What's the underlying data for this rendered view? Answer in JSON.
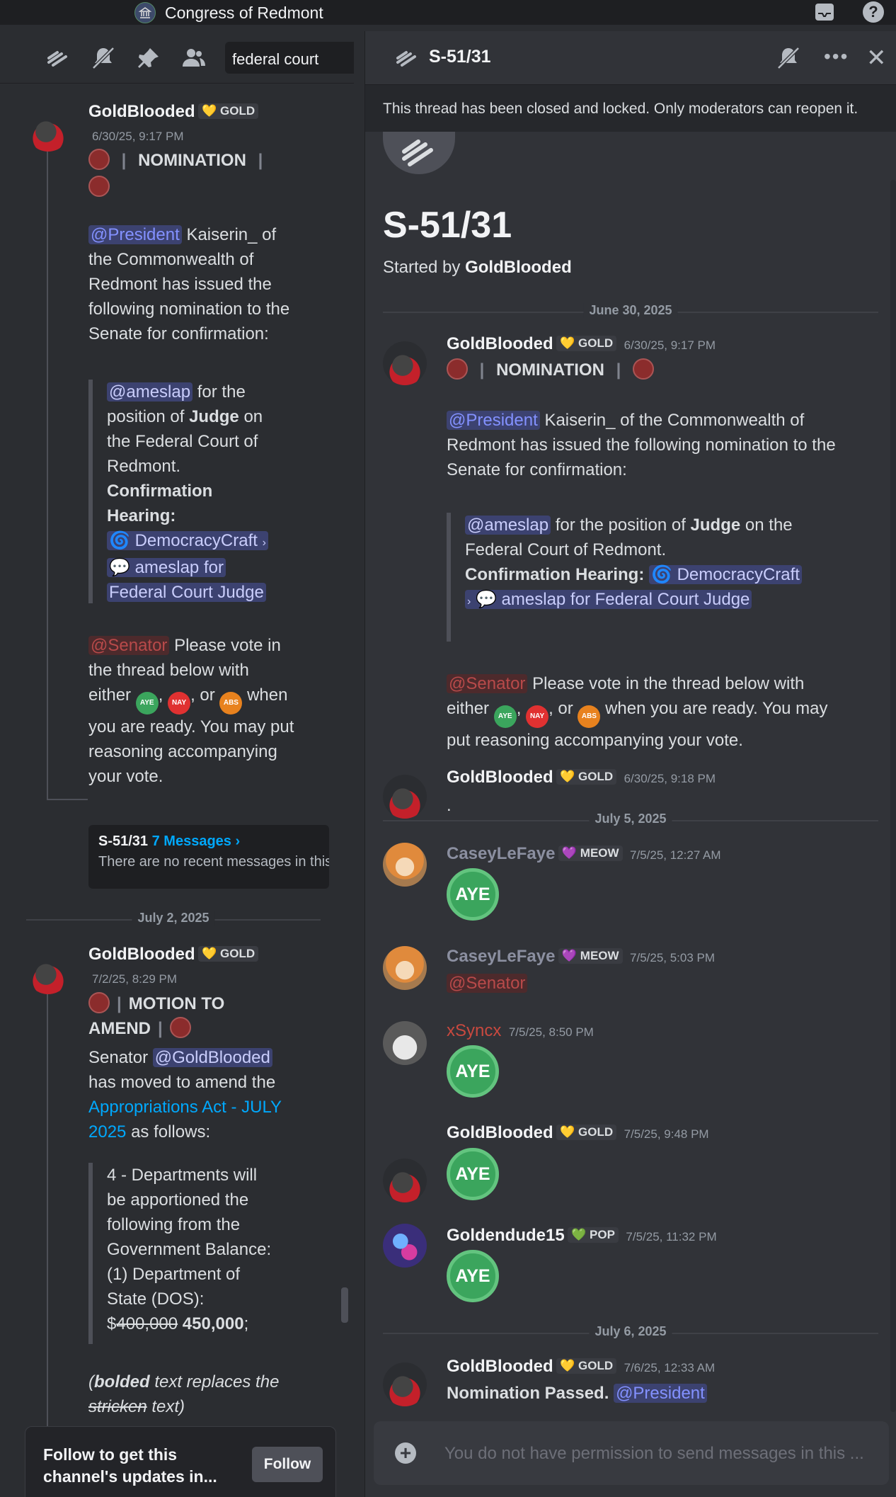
{
  "window": {
    "server_name": "Congress of Redmont"
  },
  "left_panel": {
    "search_value": "federal court",
    "msg1": {
      "author": "GoldBlooded",
      "tag": "GOLD",
      "timestamp": "6/30/25, 9:17 PM",
      "heading": "NOMINATION",
      "p1_mention": "@President",
      "p1_line1": "Kaiserin_ of",
      "p1_line2": "the Commonwealth of",
      "p1_line3": "Redmont has issued the",
      "p1_line4": "following nomination to the",
      "p1_line5": "Senate for confirmation:",
      "q_mention": "@ameslap",
      "q_line1": "for the",
      "q_line2a": "position of",
      "q_judge": "Judge",
      "q_line2b": "on",
      "q_line3": "the Federal Court of",
      "q_line4": "Redmont.",
      "q_hearing1": "Confirmation",
      "q_hearing2": "Hearing:",
      "q_channel": "DemocracyCraft",
      "q_thread1": "ameslap for",
      "q_thread2": "Federal Court Judge",
      "p2_mention": "@Senator",
      "p2_line1": "Please vote in",
      "p2_line2": "the thread below with",
      "p2_either": "either",
      "p2_or": ", or",
      "p2_when": "when",
      "p2_line4": "you are ready. You may put",
      "p2_line5": "reasoning accompanying",
      "p2_line6": "your vote."
    },
    "thread_card": {
      "name": "S-51/31",
      "count": "7 Messages ›",
      "preview": "There are no recent messages in this thread."
    },
    "date_sep": "July 2, 2025",
    "msg2": {
      "author": "GoldBlooded",
      "tag": "GOLD",
      "timestamp": "7/2/25, 8:29 PM",
      "heading1": "MOTION TO",
      "heading2": "AMEND",
      "p1a": "Senator",
      "p1_mention": "@GoldBlooded",
      "p1_line2": "has moved to amend the",
      "p1_link1": "Appropriations Act - JULY",
      "p1_link2": "2025",
      "p1_tail": "as follows:",
      "q_line1": "4 - Departments will",
      "q_line2": "be apportioned the",
      "q_line3": "following from the",
      "q_line4": "Government Balance:",
      "q_line5": "(1) Department of",
      "q_line6": "State (DOS):",
      "q_dollar": "$",
      "q_strike": "400,000",
      "q_new": "450,000",
      "q_semi": ";",
      "note_open": "(",
      "note_bold": "bolded",
      "note_mid": " text replaces the",
      "note_strike": "stricken",
      "note_close": " text)"
    },
    "follow": {
      "text1": "Follow to get this",
      "text2": "channel's updates in...",
      "button": "Follow"
    }
  },
  "right_panel": {
    "thread_title": "S-51/31",
    "banner": "This thread has been closed and locked. Only moderators can reopen it.",
    "started_prefix": "Started by",
    "started_by": "GoldBlooded",
    "date1": "June 30, 2025",
    "m1": {
      "author": "GoldBlooded",
      "tag": "GOLD",
      "timestamp": "6/30/25, 9:17 PM",
      "heading": "NOMINATION",
      "p1_mention": "@President",
      "p1_line1": "Kaiserin_ of the Commonwealth of",
      "p1_line2": "Redmont has issued the following nomination to the",
      "p1_line3": "Senate for confirmation:",
      "q_mention": "@ameslap",
      "q_line1a": "for the position of",
      "q_judge": "Judge",
      "q_line1b": "on the",
      "q_line2": "Federal Court of Redmont.",
      "q_hearing": "Confirmation Hearing:",
      "q_channel": "DemocracyCraft",
      "q_thread": "ameslap for Federal Court Judge",
      "p2_mention": "@Senator",
      "p2_line1": "Please vote in the thread below with",
      "p2_either": "either",
      "p2_or": ", or",
      "p2_tail": "when you are ready. You may",
      "p2_line3": "put reasoning accompanying your vote."
    },
    "m2": {
      "author": "GoldBlooded",
      "tag": "GOLD",
      "timestamp": "6/30/25, 9:18 PM",
      "text": "."
    },
    "date2": "July 5, 2025",
    "m3": {
      "author": "CaseyLeFaye",
      "tag": "MEOW",
      "timestamp": "7/5/25, 12:27 AM",
      "vote": "AYE"
    },
    "m4": {
      "author": "CaseyLeFaye",
      "tag": "MEOW",
      "timestamp": "7/5/25, 5:03 PM",
      "mention": "@Senator"
    },
    "m5": {
      "author": "xSyncx",
      "timestamp": "7/5/25, 8:50 PM",
      "vote": "AYE"
    },
    "m6": {
      "author": "GoldBlooded",
      "tag": "GOLD",
      "timestamp": "7/5/25, 9:48 PM",
      "vote": "AYE"
    },
    "m7": {
      "author": "Goldendude15",
      "tag": "POP",
      "timestamp": "7/5/25, 11:32 PM",
      "vote": "AYE"
    },
    "date3": "July 6, 2025",
    "m8": {
      "author": "GoldBlooded",
      "tag": "GOLD",
      "timestamp": "7/6/25, 12:33 AM",
      "text": "Nomination Passed.",
      "mention": "@President"
    },
    "composer_placeholder": "You do not have permission to send messages in this ..."
  },
  "emoji_labels": {
    "aye": "AYE",
    "nay": "NAY",
    "abs": "ABS"
  },
  "colors": {
    "accent": "#5865f2",
    "aye": "#3ba55d",
    "nay": "#e03131",
    "abs": "#e8821e",
    "mention_bg": "#3c4270",
    "senator": "#b84a4a",
    "xsyncx": "#c8493f"
  }
}
